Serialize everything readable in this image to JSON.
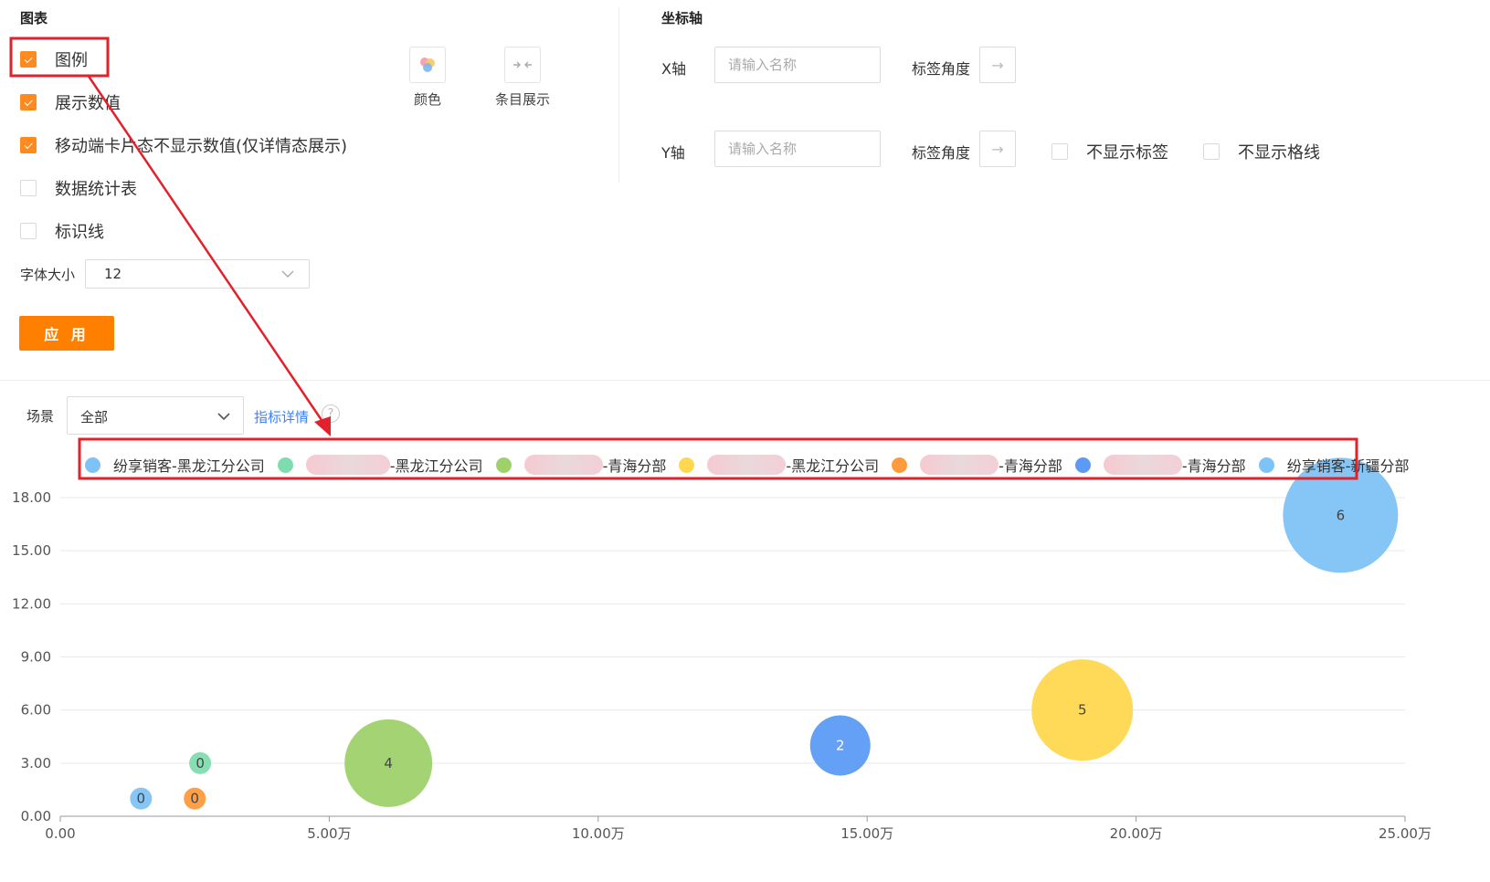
{
  "chart_settings": {
    "title": "图表",
    "options": [
      {
        "label": "图例",
        "checked": true
      },
      {
        "label": "展示数值",
        "checked": true
      },
      {
        "label": "移动端卡片态不显示数值(仅详情态展示)",
        "checked": true
      },
      {
        "label": "数据统计表",
        "checked": false
      },
      {
        "label": "标识线",
        "checked": false
      }
    ],
    "color_label": "颜色",
    "item_display_label": "条目展示",
    "font_size_label": "字体大小",
    "font_size_value": "12",
    "apply_label": "应 用"
  },
  "axis_settings": {
    "title": "坐标轴",
    "x_label": "X轴",
    "x_placeholder": "请输入名称",
    "x_angle_label": "标签角度",
    "y_label": "Y轴",
    "y_placeholder": "请输入名称",
    "y_angle_label": "标签角度",
    "hide_labels": "不显示标签",
    "hide_gridlines": "不显示格线"
  },
  "filter": {
    "scene_label": "场景",
    "scene_value": "全部",
    "metric_details": "指标详情"
  },
  "legend": [
    {
      "prefix": "纷享销客-黑龙江分公司",
      "suffix": "",
      "color": "#7ec3f7",
      "redacted": false
    },
    {
      "prefix": "",
      "suffix": "-黑龙江分公司",
      "color": "#7fdcae",
      "redacted": true
    },
    {
      "prefix": "",
      "suffix": "-青海分部",
      "color": "#9fd16b",
      "redacted": true
    },
    {
      "prefix": "",
      "suffix": "-黑龙江分公司",
      "color": "#ffd84f",
      "redacted": true
    },
    {
      "prefix": "",
      "suffix": "-青海分部",
      "color": "#ff9a3d",
      "redacted": true
    },
    {
      "prefix": "",
      "suffix": "-青海分部",
      "color": "#5b9bf5",
      "redacted": true
    },
    {
      "prefix": "纷享销客-新疆分部",
      "suffix": "",
      "color": "#7ec3f7",
      "redacted": false
    }
  ],
  "chart_data": {
    "type": "scatter",
    "subtype": "bubble",
    "xlim": [
      0,
      250000
    ],
    "ylim": [
      0,
      18
    ],
    "x_ticks": [
      "0.00",
      "5.00万",
      "10.00万",
      "15.00万",
      "20.00万",
      "25.00万"
    ],
    "y_ticks": [
      "0.00",
      "3.00",
      "6.00",
      "9.00",
      "12.00",
      "15.00",
      "18.00"
    ],
    "grid": true,
    "legend_position": "top",
    "points": [
      {
        "x": 15000,
        "y": 1,
        "label": "0",
        "color": "#7ec3f7"
      },
      {
        "x": 26000,
        "y": 3,
        "label": "0",
        "color": "#7fdcae"
      },
      {
        "x": 25000,
        "y": 1,
        "label": "0",
        "color": "#ff9a3d"
      },
      {
        "x": 61000,
        "y": 3,
        "label": "4",
        "color": "#9fd16b"
      },
      {
        "x": 145000,
        "y": 4,
        "label": "2",
        "color": "#5b9bf5"
      },
      {
        "x": 190000,
        "y": 6,
        "label": "5",
        "color": "#ffd84f"
      },
      {
        "x": 238000,
        "y": 17,
        "label": "6",
        "color": "#7ec3f7"
      }
    ]
  },
  "annotation_color": "#e3212a"
}
